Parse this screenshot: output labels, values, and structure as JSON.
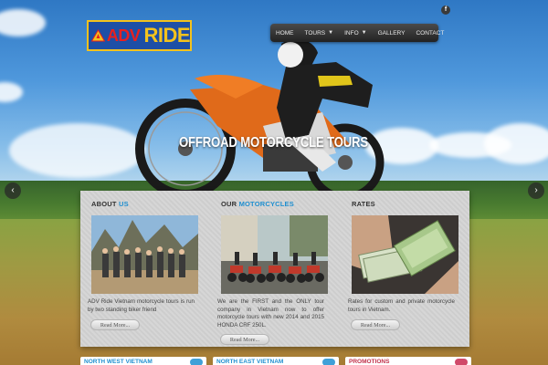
{
  "header": {
    "logo": {
      "adv": "ADV",
      "ride": "RIDE"
    },
    "social": {
      "facebook_label": "f"
    }
  },
  "nav": {
    "items": [
      {
        "label": "HOME",
        "has_dropdown": false
      },
      {
        "label": "TOURS",
        "has_dropdown": true
      },
      {
        "label": "INFO",
        "has_dropdown": true
      },
      {
        "label": "GALLERY",
        "has_dropdown": false
      },
      {
        "label": "CONTACT",
        "has_dropdown": false
      }
    ],
    "caret": "▼"
  },
  "hero": {
    "tagline": "OFFROAD MOTORCYCLE TOURS",
    "prev_label": "‹",
    "next_label": "›"
  },
  "columns": [
    {
      "title_plain": "ABOUT ",
      "title_highlight": "US",
      "text": "ADV Ride Vietnam motorcycle tours is run by two standing biker friend",
      "button": "Read More..."
    },
    {
      "title_plain": "OUR ",
      "title_highlight": "MOTORCYCLES",
      "text": "We are the FIRST and the ONLY tour company in Vietnam now to offer motorcycle tours with new 2014 and 2015 HONDA CRF 250L.",
      "button": "Read More..."
    },
    {
      "title_plain": "RATES",
      "title_highlight": "",
      "text": "Rates for custom and private motorcycle tours in Vietnam.",
      "button": "Read More..."
    }
  ],
  "strips": [
    {
      "label": "NORTH WEST VIETNAM",
      "color": "#1f8fd0"
    },
    {
      "label": "NORTH EAST VIETNAM",
      "color": "#1f8fd0"
    },
    {
      "label": "PROMOTIONS",
      "color": "#c0304a"
    }
  ],
  "colors": {
    "accent": "#1f8fd0",
    "logo_bg": "#1d4fa6",
    "logo_yellow": "#f3c21d",
    "logo_red": "#e8201f"
  }
}
